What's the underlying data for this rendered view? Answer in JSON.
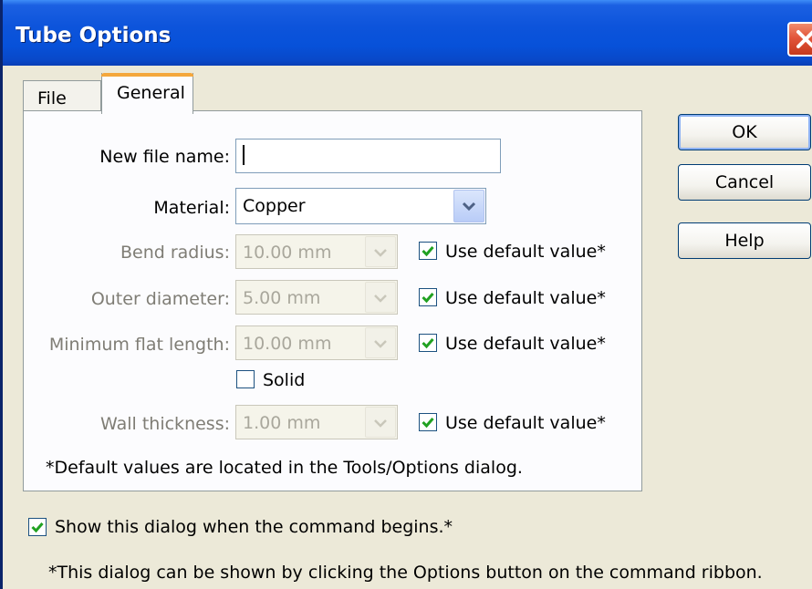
{
  "window": {
    "title": "Tube Options"
  },
  "tabs": [
    {
      "label": "File",
      "active": false
    },
    {
      "label": "General",
      "active": true
    }
  ],
  "form": {
    "new_file_name": {
      "label": "New file name:",
      "value": ""
    },
    "material": {
      "label": "Material:",
      "value": "Copper"
    },
    "bend_radius": {
      "label": "Bend radius:",
      "value": "10.00 mm",
      "use_default_label": "Use default value*",
      "use_default": true
    },
    "outer_diameter": {
      "label": "Outer diameter:",
      "value": "5.00 mm",
      "use_default_label": "Use default value*",
      "use_default": true
    },
    "min_flat_length": {
      "label": "Minimum flat length:",
      "value": "10.00 mm",
      "use_default_label": "Use default value*",
      "use_default": true
    },
    "solid": {
      "label": "Solid",
      "checked": false
    },
    "wall_thickness": {
      "label": "Wall thickness:",
      "value": "1.00 mm",
      "use_default_label": "Use default value*",
      "use_default": true
    },
    "footnote": "*Default values are located in the Tools/Options dialog."
  },
  "buttons": {
    "ok": "OK",
    "cancel": "Cancel",
    "help": "Help"
  },
  "show_dialog": {
    "label": "Show this dialog when the command begins.*",
    "checked": true
  },
  "bottom_note": "*This dialog can be shown by clicking the Options button on the command ribbon.",
  "colors": {
    "titlebar": "#0a54d8",
    "dialog_bg": "#ece9d8",
    "tab_accent": "#f4a73c",
    "check_mark": "#21a121"
  }
}
